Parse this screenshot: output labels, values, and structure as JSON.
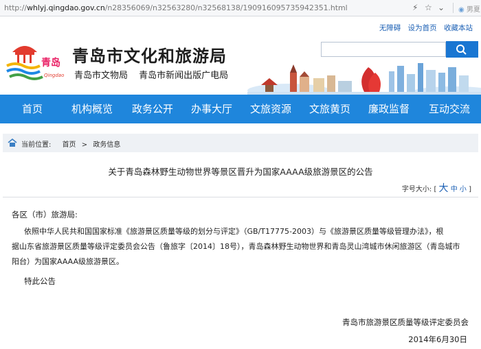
{
  "browser": {
    "url_prefix": "http://",
    "url_host": "whlyj.qingdao.gov.cn",
    "url_path": "/n28356069/n32563280/n32568138/190916095735942351.html",
    "ext_label": "男夏"
  },
  "header": {
    "top_links": [
      "无障碍",
      "设为首页",
      "收藏本站"
    ],
    "site_title": "青岛市文化和旅游局",
    "subtitles": [
      "青岛市文物局",
      "青岛市新闻出版广电局"
    ],
    "logo_text": "青岛",
    "logo_text_en": "Qingdao"
  },
  "nav": {
    "items": [
      "首页",
      "机构概览",
      "政务公开",
      "办事大厅",
      "文旅资源",
      "文旅黄页",
      "廉政监督",
      "互动交流"
    ]
  },
  "breadcrumb": {
    "label": "当前位置:",
    "items": [
      "首页",
      ">",
      "政务信息"
    ]
  },
  "article": {
    "title": "关于青岛森林野生动物世界等景区晋升为国家AAAA级旅游景区的公告",
    "font_size_label": "字号大小:",
    "font_size_open": "[",
    "font_large": "大",
    "font_medium": "中",
    "font_small": "小",
    "font_size_close": "]",
    "salutation": "各区（市）旅游局:",
    "body_lines": [
      "依照中华人民共和国国家标准《旅游景区质量等级的划分与评定》（GB/T17775-2003）与《旅游景区质量等级管理办法》，根",
      "据山东省旅游景区质量等级评定委员会公告（鲁旅字〔2014〕18号），青岛森林野生动物世界和青岛灵山湾城市休闲旅游区（青岛城市",
      "阳台）为国家AAAA级旅游景区。"
    ],
    "closing": "特此公告",
    "signature": "青岛市旅游景区质量等级评定委员会",
    "date": "2014年6月30日"
  },
  "colors": {
    "nav_bg": "#1f86dc",
    "link": "#1a5fb4",
    "search_btn": "#1976d2"
  }
}
